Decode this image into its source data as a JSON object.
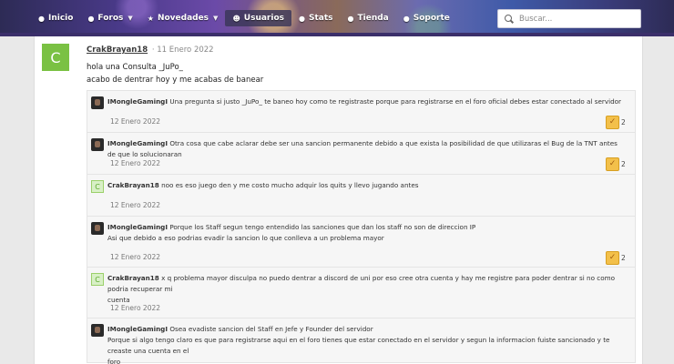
{
  "nav": {
    "items": [
      {
        "label": "Inicio",
        "icon": "tag-icon"
      },
      {
        "label": "Foros",
        "icon": "comments-icon"
      },
      {
        "label": "Novedades",
        "icon": "star-icon"
      },
      {
        "label": "Usuarios",
        "icon": "user-icon"
      },
      {
        "label": "Stats",
        "icon": "tag-icon"
      },
      {
        "label": "Tienda",
        "icon": "tag-icon"
      },
      {
        "label": "Soporte",
        "icon": "tag-icon"
      }
    ],
    "search_placeholder": "Buscar..."
  },
  "post": {
    "avatar_letter": "C",
    "author": "CrakBrayan18",
    "date": "· 11 Enero 2022",
    "lines": [
      "hola una Consulta _JuPo_",
      "acabo de dentrar hoy y me acabas de banear"
    ]
  },
  "comments": [
    {
      "author": "IMongleGamingI",
      "text": "Una pregunta si justo _JuPo_ te baneo hoy como te registraste porque para registrarse en el foro oficial debes estar conectado al servidor",
      "text2": "",
      "date": "12 Enero 2022",
      "likes": "2"
    },
    {
      "author": "IMongleGamingI",
      "text": "Otra cosa que cabe aclarar debe ser una sancion permanente debido a que exista la posibilidad de que utilizaras el Bug de la TNT antes de que lo solucionaran",
      "text2": "",
      "date": "12 Enero 2022",
      "likes": "2"
    },
    {
      "author": "CrakBrayan18",
      "text": "noo es eso juego den y me costo mucho adquir los quits y llevo jugando antes",
      "text2": "",
      "date": "12 Enero 2022",
      "likes": ""
    },
    {
      "author": "IMongleGamingI",
      "text": "Porque los Staff segun tengo entendido las sanciones que dan los staff no son de direccion IP",
      "text2": "Asi que debido a eso podrias evadir la sancion lo que conlleva a un problema mayor",
      "date": "12 Enero 2022",
      "likes": "2"
    },
    {
      "author": "CrakBrayan18",
      "text": "x q problema mayor disculpa no puedo dentrar a discord de uni por eso cree otra cuenta y hay me registre para poder dentrar si no como podria recuperar mi",
      "text2": "cuenta",
      "date": "12 Enero 2022",
      "likes": ""
    },
    {
      "author": "IMongleGamingI",
      "text": "Osea evadiste sancion del Staff en Jefe y Founder del servidor",
      "text2": "Porque si algo tengo claro es que para registrarse aqui en el foro tienes que estar conectado en el servidor y segun la informacion fuiste sancionado y te creaste una cuenta en el",
      "text3": "foro",
      "date": "",
      "likes": ""
    }
  ]
}
